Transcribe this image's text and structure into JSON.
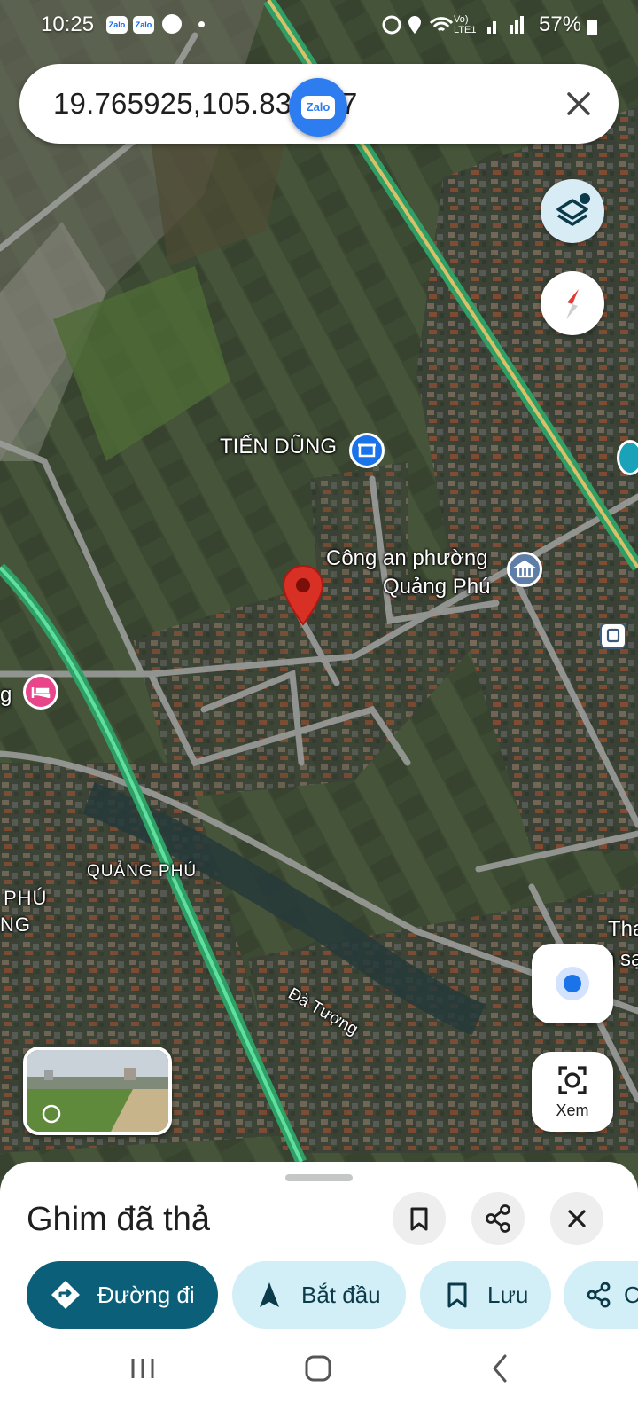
{
  "status_bar": {
    "time": "10:25",
    "notif_zalo_1": "Zalo",
    "notif_zalo_2": "Zalo",
    "network": "Vo) LTE1",
    "battery": "57%"
  },
  "search": {
    "query": "19.765925,105.832417"
  },
  "zalo_bubble_label": "Zalo",
  "map": {
    "labels": {
      "tien_dung": "TIẾN DŨNG",
      "cong_an_line1": "Công an phường",
      "cong_an_line2": "Quảng Phú",
      "quang_phu_area": "QUẢNG PHÚ",
      "phu_partial": "PHÚ",
      "ng_partial": "NG",
      "g_partial": "g",
      "tha_partial": "Tha",
      "sa_partial": "h sạ",
      "road": "Đà Tượng"
    }
  },
  "controls": {
    "xem_label": "Xem"
  },
  "sheet": {
    "title": "Ghim đã thả",
    "actions": {
      "directions": "Đường đi",
      "start": "Bắt đầu",
      "save": "Lưu",
      "share_partial": "C"
    }
  },
  "colors": {
    "primary_button": "#0b5f78",
    "secondary_button": "#d2eef7",
    "pin": "#d93025",
    "highway": "#36c580",
    "police_badge": "#1a73e8",
    "hotel_badge": "#e8458b",
    "location_dot": "#1a73e8"
  }
}
